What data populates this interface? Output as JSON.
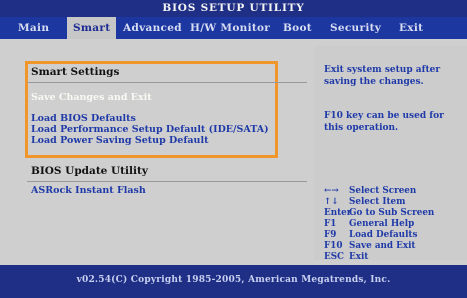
{
  "app": {
    "title": "BIOS SETUP UTILITY"
  },
  "menu": {
    "tabs": [
      {
        "label": "Main"
      },
      {
        "label": "Smart",
        "active": true
      },
      {
        "label": "Advanced"
      },
      {
        "label": "H/W Monitor"
      },
      {
        "label": "Boot"
      },
      {
        "label": "Security"
      },
      {
        "label": "Exit"
      }
    ]
  },
  "main": {
    "section1": {
      "title": "Smart Settings",
      "items": [
        {
          "label": "Save Changes and Exit",
          "selected": true
        },
        {
          "label": "Load BIOS Defaults"
        },
        {
          "label": "Load Performance Setup Default (IDE/SATA)"
        },
        {
          "label": "Load Power Saving Setup Default"
        }
      ]
    },
    "section2": {
      "title": "BIOS Update Utility",
      "items": [
        {
          "label": "ASRock Instant Flash"
        }
      ]
    }
  },
  "help": {
    "line1": "Exit system setup after saving the changes.",
    "line2": "F10 key can be used for this operation."
  },
  "keys": [
    {
      "key": "←→",
      "desc": "Select Screen"
    },
    {
      "key": "↑↓",
      "desc": "Select Item"
    },
    {
      "key": "Enter",
      "desc": "Go to Sub Screen"
    },
    {
      "key": "F1",
      "desc": "General Help"
    },
    {
      "key": "F9",
      "desc": "Load Defaults"
    },
    {
      "key": "F10",
      "desc": "Save and Exit"
    },
    {
      "key": "ESC",
      "desc": "Exit"
    }
  ],
  "footer": {
    "copyright": "v02.54(C) Copyright 1985-2005, American Megatrends, Inc."
  },
  "colors": {
    "title_bar": "#1f2f86",
    "menu_bar": "#1c37a0",
    "panel_bg": "#cfcfcf",
    "highlight": "#f0962a",
    "text_blue": "#1f3aa8"
  }
}
